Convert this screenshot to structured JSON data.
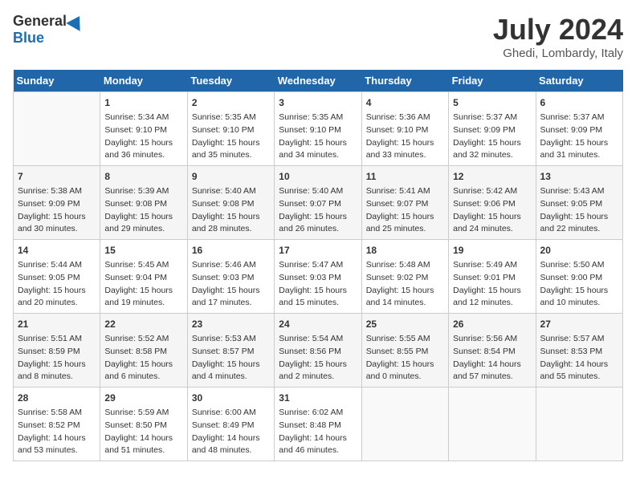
{
  "header": {
    "logo_general": "General",
    "logo_blue": "Blue",
    "month_year": "July 2024",
    "location": "Ghedi, Lombardy, Italy"
  },
  "calendar": {
    "days_of_week": [
      "Sunday",
      "Monday",
      "Tuesday",
      "Wednesday",
      "Thursday",
      "Friday",
      "Saturday"
    ],
    "weeks": [
      [
        {
          "day": "",
          "info": ""
        },
        {
          "day": "1",
          "info": "Sunrise: 5:34 AM\nSunset: 9:10 PM\nDaylight: 15 hours\nand 36 minutes."
        },
        {
          "day": "2",
          "info": "Sunrise: 5:35 AM\nSunset: 9:10 PM\nDaylight: 15 hours\nand 35 minutes."
        },
        {
          "day": "3",
          "info": "Sunrise: 5:35 AM\nSunset: 9:10 PM\nDaylight: 15 hours\nand 34 minutes."
        },
        {
          "day": "4",
          "info": "Sunrise: 5:36 AM\nSunset: 9:10 PM\nDaylight: 15 hours\nand 33 minutes."
        },
        {
          "day": "5",
          "info": "Sunrise: 5:37 AM\nSunset: 9:09 PM\nDaylight: 15 hours\nand 32 minutes."
        },
        {
          "day": "6",
          "info": "Sunrise: 5:37 AM\nSunset: 9:09 PM\nDaylight: 15 hours\nand 31 minutes."
        }
      ],
      [
        {
          "day": "7",
          "info": "Sunrise: 5:38 AM\nSunset: 9:09 PM\nDaylight: 15 hours\nand 30 minutes."
        },
        {
          "day": "8",
          "info": "Sunrise: 5:39 AM\nSunset: 9:08 PM\nDaylight: 15 hours\nand 29 minutes."
        },
        {
          "day": "9",
          "info": "Sunrise: 5:40 AM\nSunset: 9:08 PM\nDaylight: 15 hours\nand 28 minutes."
        },
        {
          "day": "10",
          "info": "Sunrise: 5:40 AM\nSunset: 9:07 PM\nDaylight: 15 hours\nand 26 minutes."
        },
        {
          "day": "11",
          "info": "Sunrise: 5:41 AM\nSunset: 9:07 PM\nDaylight: 15 hours\nand 25 minutes."
        },
        {
          "day": "12",
          "info": "Sunrise: 5:42 AM\nSunset: 9:06 PM\nDaylight: 15 hours\nand 24 minutes."
        },
        {
          "day": "13",
          "info": "Sunrise: 5:43 AM\nSunset: 9:05 PM\nDaylight: 15 hours\nand 22 minutes."
        }
      ],
      [
        {
          "day": "14",
          "info": "Sunrise: 5:44 AM\nSunset: 9:05 PM\nDaylight: 15 hours\nand 20 minutes."
        },
        {
          "day": "15",
          "info": "Sunrise: 5:45 AM\nSunset: 9:04 PM\nDaylight: 15 hours\nand 19 minutes."
        },
        {
          "day": "16",
          "info": "Sunrise: 5:46 AM\nSunset: 9:03 PM\nDaylight: 15 hours\nand 17 minutes."
        },
        {
          "day": "17",
          "info": "Sunrise: 5:47 AM\nSunset: 9:03 PM\nDaylight: 15 hours\nand 15 minutes."
        },
        {
          "day": "18",
          "info": "Sunrise: 5:48 AM\nSunset: 9:02 PM\nDaylight: 15 hours\nand 14 minutes."
        },
        {
          "day": "19",
          "info": "Sunrise: 5:49 AM\nSunset: 9:01 PM\nDaylight: 15 hours\nand 12 minutes."
        },
        {
          "day": "20",
          "info": "Sunrise: 5:50 AM\nSunset: 9:00 PM\nDaylight: 15 hours\nand 10 minutes."
        }
      ],
      [
        {
          "day": "21",
          "info": "Sunrise: 5:51 AM\nSunset: 8:59 PM\nDaylight: 15 hours\nand 8 minutes."
        },
        {
          "day": "22",
          "info": "Sunrise: 5:52 AM\nSunset: 8:58 PM\nDaylight: 15 hours\nand 6 minutes."
        },
        {
          "day": "23",
          "info": "Sunrise: 5:53 AM\nSunset: 8:57 PM\nDaylight: 15 hours\nand 4 minutes."
        },
        {
          "day": "24",
          "info": "Sunrise: 5:54 AM\nSunset: 8:56 PM\nDaylight: 15 hours\nand 2 minutes."
        },
        {
          "day": "25",
          "info": "Sunrise: 5:55 AM\nSunset: 8:55 PM\nDaylight: 15 hours\nand 0 minutes."
        },
        {
          "day": "26",
          "info": "Sunrise: 5:56 AM\nSunset: 8:54 PM\nDaylight: 14 hours\nand 57 minutes."
        },
        {
          "day": "27",
          "info": "Sunrise: 5:57 AM\nSunset: 8:53 PM\nDaylight: 14 hours\nand 55 minutes."
        }
      ],
      [
        {
          "day": "28",
          "info": "Sunrise: 5:58 AM\nSunset: 8:52 PM\nDaylight: 14 hours\nand 53 minutes."
        },
        {
          "day": "29",
          "info": "Sunrise: 5:59 AM\nSunset: 8:50 PM\nDaylight: 14 hours\nand 51 minutes."
        },
        {
          "day": "30",
          "info": "Sunrise: 6:00 AM\nSunset: 8:49 PM\nDaylight: 14 hours\nand 48 minutes."
        },
        {
          "day": "31",
          "info": "Sunrise: 6:02 AM\nSunset: 8:48 PM\nDaylight: 14 hours\nand 46 minutes."
        },
        {
          "day": "",
          "info": ""
        },
        {
          "day": "",
          "info": ""
        },
        {
          "day": "",
          "info": ""
        }
      ]
    ]
  }
}
